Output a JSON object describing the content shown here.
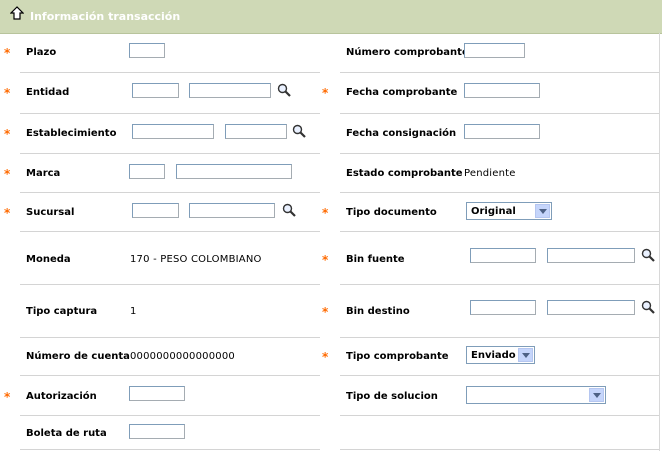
{
  "header": {
    "title": "Información transacción",
    "icon": "upload-arrow-icon"
  },
  "required_marker": "*",
  "left": {
    "plazo": "Plazo",
    "entidad": "Entidad",
    "establecimiento": "Establecimiento",
    "marca": "Marca",
    "sucursal": "Sucursal",
    "moneda": "Moneda",
    "moneda_value": "170 - PESO COLOMBIANO",
    "tipo_captura": "Tipo captura",
    "tipo_captura_value": "1",
    "numero_cuenta": "Número de cuenta",
    "numero_cuenta_value": "0000000000000000",
    "autorizacion": "Autorización",
    "boleta_ruta": "Boleta de ruta"
  },
  "right": {
    "numero_comprobante": "Número comprobante",
    "fecha_comprobante": "Fecha comprobante",
    "fecha_consignacion": "Fecha consignación",
    "estado_comprobante": "Estado comprobante",
    "estado_comprobante_value": "Pendiente",
    "tipo_documento": "Tipo documento",
    "tipo_documento_value": "Original",
    "bin_fuente": "Bin fuente",
    "bin_destino": "Bin destino",
    "tipo_comprobante": "Tipo comprobante",
    "tipo_comprobante_value": "Enviado",
    "tipo_solucion": "Tipo de solucion",
    "tipo_solucion_value": ""
  },
  "colors": {
    "header_bg": "#cfd9b6",
    "required": "#ff6a00",
    "grid": "#d4d4d4"
  }
}
